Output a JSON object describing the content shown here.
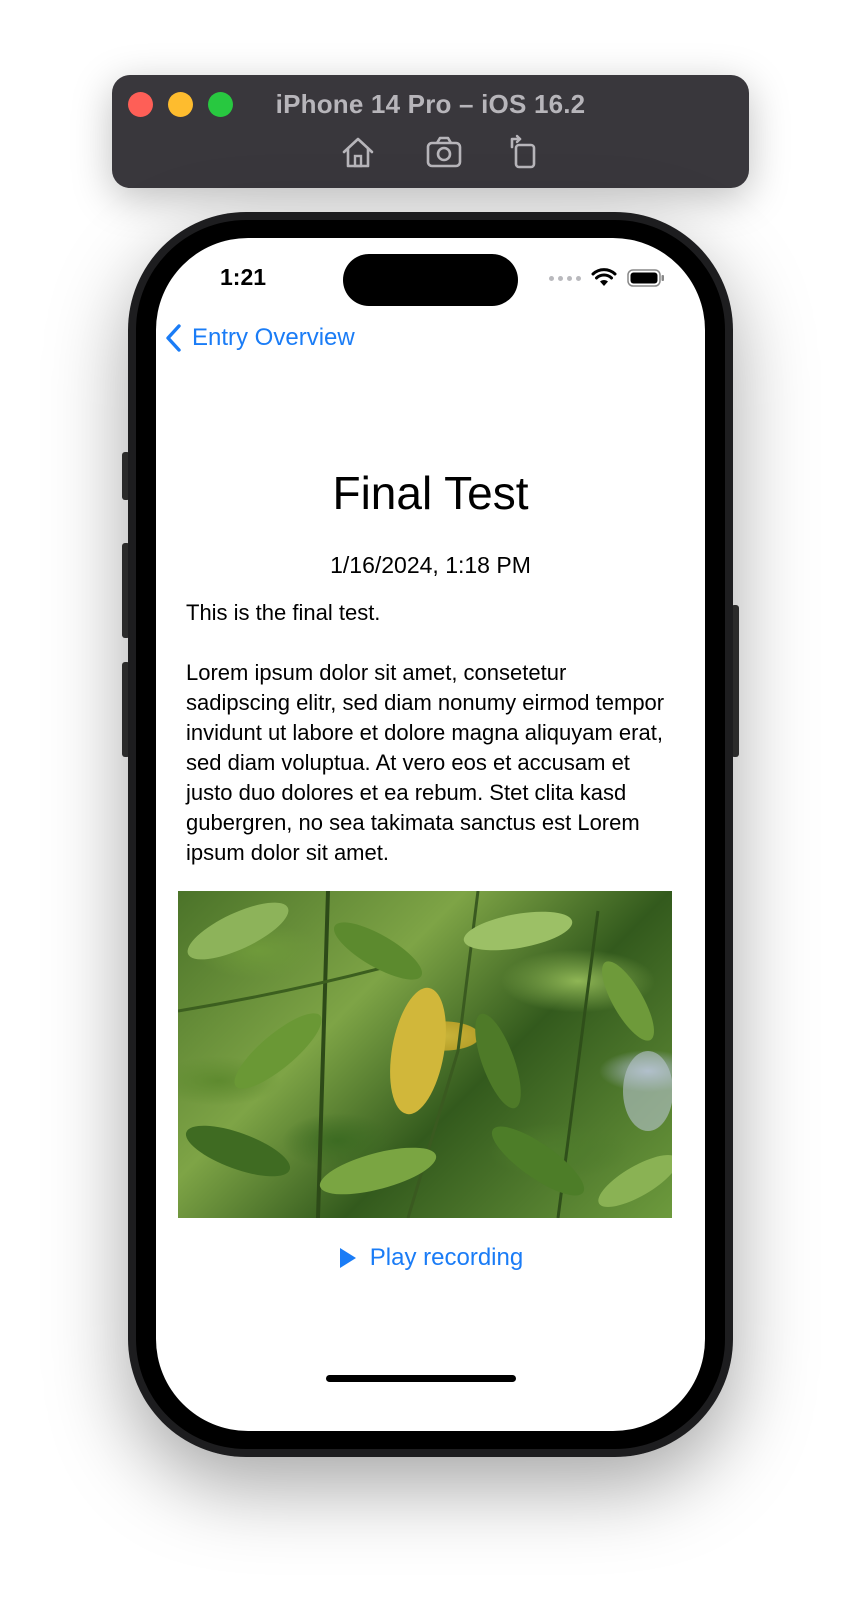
{
  "window": {
    "title": "iPhone 14 Pro – iOS 16.2",
    "toolbar": [
      "home-icon",
      "screenshot-icon",
      "rotate-icon"
    ]
  },
  "status_bar": {
    "time": "1:21"
  },
  "nav": {
    "back_label": "Entry Overview"
  },
  "entry": {
    "title": "Final Test",
    "date": "1/16/2024, 1:18 PM",
    "summary": "This is the final test.",
    "body": "Lorem ipsum dolor sit amet, consetetur sadipscing elitr, sed diam nonumy eirmod tempor invidunt ut labore et dolore magna aliquyam erat, sed diam voluptua. At vero eos et accusam et justo duo dolores et ea rebum. Stet clita kasd gubergren, no sea takimata sanctus est Lorem ipsum dolor sit amet.",
    "photo": "leaf-photo"
  },
  "actions": {
    "play_label": "Play recording"
  },
  "colors": {
    "accent": "#1a7cf6",
    "titlebar": "#39373c"
  }
}
